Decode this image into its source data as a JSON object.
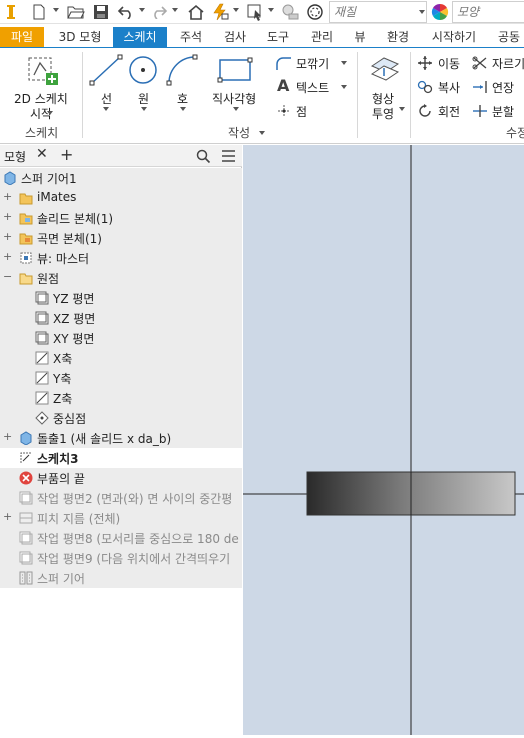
{
  "qat": {
    "material_placeholder": "재질",
    "appearance_placeholder": "모양"
  },
  "tabs": [
    "파일",
    "3D 모형",
    "스케치",
    "주석",
    "검사",
    "도구",
    "관리",
    "뷰",
    "환경",
    "시작하기",
    "공동"
  ],
  "ribbon": {
    "sketch_start": {
      "line1": "2D 스케치",
      "line2": "시작"
    },
    "sketch_group": "스케치",
    "line": "선",
    "circle": "원",
    "arc": "호",
    "rectangle": "직사각형",
    "fillet": "모깎기",
    "text": "텍스트",
    "point": "점",
    "create_group": "작성",
    "project": {
      "line1": "형상",
      "line2": "투영"
    },
    "move": "이동",
    "copy": "복사",
    "rotate": "회전",
    "trim": "자르기",
    "extend": "연장",
    "split": "분할",
    "modify_group": "수정"
  },
  "browser": {
    "tab_label": "모형",
    "tree": [
      {
        "label": "스퍼 기어1"
      },
      {
        "label": "iMates"
      },
      {
        "label": "솔리드 본체(1)"
      },
      {
        "label": "곡면 본체(1)"
      },
      {
        "label": "뷰: 마스터"
      },
      {
        "label": "원점"
      },
      {
        "label": "YZ 평면"
      },
      {
        "label": "XZ 평면"
      },
      {
        "label": "XY 평면"
      },
      {
        "label": "X축"
      },
      {
        "label": "Y축"
      },
      {
        "label": "Z축"
      },
      {
        "label": "중심점"
      },
      {
        "label": "돌출1 (새 솔리드 x da_b)"
      },
      {
        "label": "스케치3"
      },
      {
        "label": "부품의 끝"
      },
      {
        "label": "작업 평면2 (면과(와) 면 사이의 중간평"
      },
      {
        "label": "피치 지름 (전체)"
      },
      {
        "label": "작업 평면8 (모서리를 중심으로 180 de"
      },
      {
        "label": "작업 평면9 (다음 위치에서 간격띄우기"
      },
      {
        "label": "스퍼 기어"
      }
    ]
  },
  "colors": {
    "accent": "#1b80c9",
    "file_tab": "#f0a000",
    "canvas_bg": "#cdd8e6"
  }
}
